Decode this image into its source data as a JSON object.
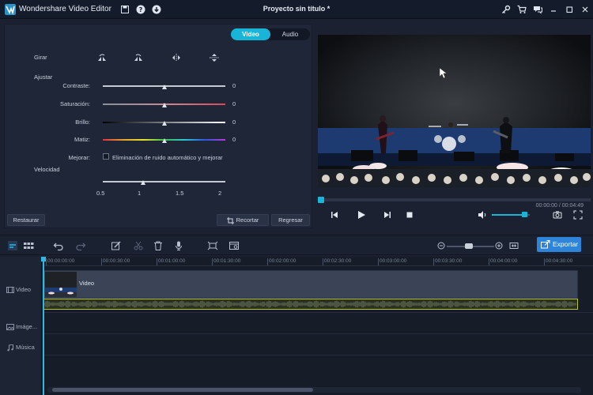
{
  "app": {
    "title": "Wondershare Video Editor",
    "project_title": "Proyecto sin título *",
    "accent_color": "#19b5d9",
    "export_color": "#2e84d8"
  },
  "titlebar_icons": [
    "save-icon",
    "help-icon",
    "download-icon",
    "key-icon",
    "cart-icon",
    "chat-icon",
    "minimize-icon",
    "maximize-icon",
    "close-icon"
  ],
  "edit_panel": {
    "tabs": [
      {
        "label": "Video",
        "active": true
      },
      {
        "label": "Audio",
        "active": false
      }
    ],
    "rotate_label": "Girar",
    "rotate_icons": [
      "rotate-left-icon",
      "rotate-right-icon",
      "flip-horizontal-icon",
      "flip-vertical-icon"
    ],
    "adjust_label": "Ajustar",
    "sliders": [
      {
        "label": "Contraste:",
        "value": "0",
        "position": 0.5,
        "track": "#c5c9d1"
      },
      {
        "label": "Saturación:",
        "value": "0",
        "position": 0.5,
        "track": "#c98a91"
      },
      {
        "label": "Brillo:",
        "value": "0",
        "position": 0.5,
        "track": "gradient-black-white"
      },
      {
        "label": "Matiz:",
        "value": "0",
        "position": 0.5,
        "track": "gradient-hue"
      }
    ],
    "enhance_label": "Mejorar:",
    "enhance_option": "Eliminación de ruido automático y mejorar",
    "enhance_checked": false,
    "speed_label": "Velocidad",
    "speed_ticks": [
      "0.5",
      "1",
      "1.5",
      "2"
    ],
    "speed_value": 1,
    "restore_button": "Restaurar",
    "crop_button": "Recortar",
    "back_button": "Regresar"
  },
  "preview": {
    "timecode": "00:00:00 / 00:04:49",
    "progress": 0,
    "volume": 0.85
  },
  "toolbar": {
    "icons": [
      "timeline-view-icon",
      "storyboard-view-icon",
      "undo-icon",
      "redo-icon",
      "edit-icon",
      "cut-icon",
      "delete-icon",
      "record-icon",
      "crop-icon",
      "snapshot-icon"
    ],
    "zoom_level": 0.45,
    "export_label": "Exportar"
  },
  "timeline": {
    "ruler": [
      "00:00:00:00",
      "00:00:30:00",
      "00:01:00:00",
      "00:01:30:00",
      "00:02:00:00",
      "00:02:30:00",
      "00:03:00:00",
      "00:03:30:00",
      "00:04:00:00",
      "00:04:30:00"
    ],
    "tracks": [
      {
        "label": "Video",
        "icon": "video-track-icon"
      },
      {
        "label": "Imáge...",
        "icon": "image-track-icon"
      },
      {
        "label": "Música",
        "icon": "music-track-icon"
      }
    ],
    "video_clip_name": "Video"
  }
}
